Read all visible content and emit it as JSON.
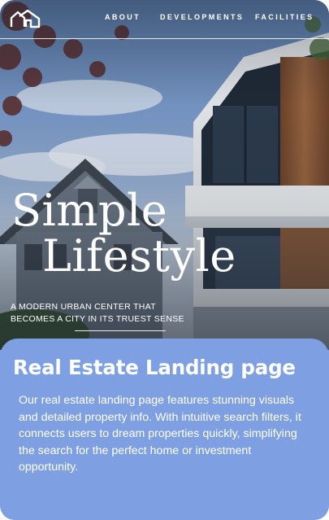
{
  "header": {
    "logo": "house-logo-icon",
    "nav": [
      {
        "label": "ABOUT"
      },
      {
        "label": "DEVELOPMENTS"
      },
      {
        "label": "FACILITIES"
      }
    ]
  },
  "hero": {
    "headline_line1": "Simple",
    "headline_line2": "Lifestyle",
    "tagline": "A MODERN URBAN CENTER THAT BECOMES A CITY IN ITS TRUEST SENSE"
  },
  "card": {
    "title": "Real Estate Landing page",
    "description": "Our real estate landing page features stunning visuals and detailed property info. With intuitive search filters, it connects users to dream properties quickly, simplifying the search for the perfect home or investment opportunity.",
    "background": "#7f9fe3"
  }
}
